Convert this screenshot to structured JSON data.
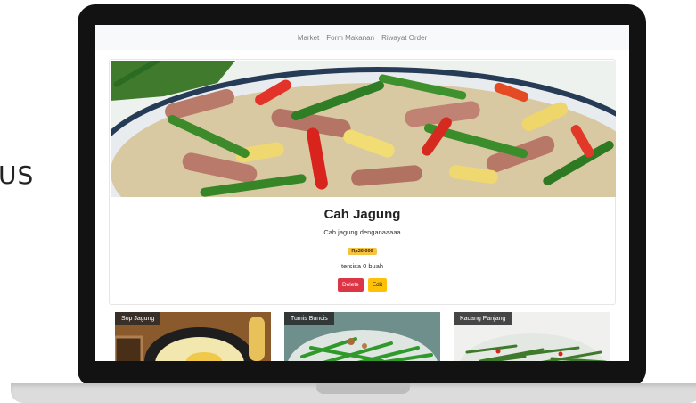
{
  "side_text": "US",
  "navbar": {
    "items": [
      "Market",
      "Form Makanan",
      "Riwayat Order"
    ]
  },
  "featured": {
    "title": "Cah Jagung",
    "description": "Cah jagung denganaaaaa",
    "price": "Rp20.000",
    "stock": "tersisa 0 buah",
    "delete_label": "Delete",
    "edit_label": "Edit"
  },
  "thumbnails": [
    {
      "label": "Sop Jagung"
    },
    {
      "label": "Tumis Buncis"
    },
    {
      "label": "Kacang Panjang"
    }
  ],
  "colors": {
    "delete": "#dc3545",
    "edit": "#ffc107",
    "price_badge": "#f5c242",
    "laptop_bezel": "#121212"
  }
}
